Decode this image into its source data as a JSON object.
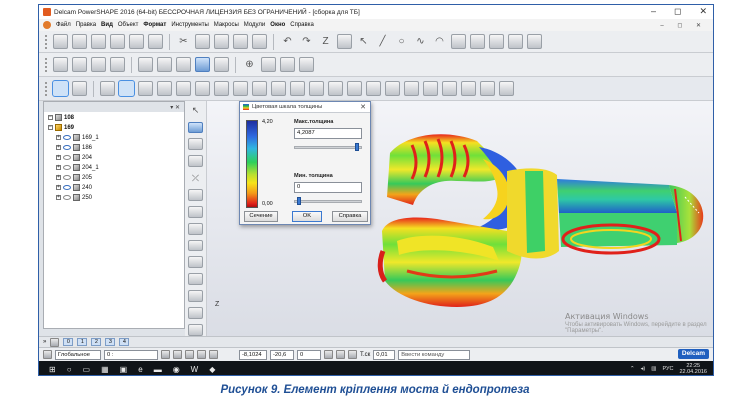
{
  "window": {
    "title": "Delcam PowerSHAPE 2016 (64-bit) БЕССРОЧНАЯ ЛИЦЕНЗИЯ БЕЗ ОГРАНИЧЕНИЙ - [сборка для ТБ]",
    "controls": [
      "–",
      "◻",
      "✕"
    ]
  },
  "menu": {
    "items": [
      "Файл",
      "Правка",
      "Вид",
      "Объект",
      "Формат",
      "Инструменты",
      "Макросы",
      "Модули",
      "Окно",
      "Справка"
    ],
    "mdi_controls": "– ◻ ✕"
  },
  "tree": {
    "header_controls": "▾ ✕",
    "nodes": [
      {
        "id": "n0",
        "label": "108",
        "bold": true,
        "level": 0
      },
      {
        "id": "n1",
        "label": "169",
        "bold": true,
        "level": 0
      },
      {
        "id": "n2",
        "label": "169_1",
        "bold": false,
        "level": 1
      },
      {
        "id": "n3",
        "label": "186",
        "bold": false,
        "level": 1
      },
      {
        "id": "n4",
        "label": "204",
        "bold": false,
        "level": 1
      },
      {
        "id": "n5",
        "label": "204_1",
        "bold": false,
        "level": 1
      },
      {
        "id": "n6",
        "label": "205",
        "bold": false,
        "level": 1
      },
      {
        "id": "n7",
        "label": "240",
        "bold": false,
        "level": 1
      },
      {
        "id": "n8",
        "label": "250",
        "bold": false,
        "level": 1
      }
    ]
  },
  "dialog": {
    "title": "Цветовая шкала толщины",
    "scale_max_value": "4,20",
    "scale_min_value": "0,00",
    "max_label": "Макс.толщина",
    "max_value": "4,2087",
    "max_slider_level": 0.95,
    "min_label": "Мин. толщина",
    "min_value": "0",
    "min_slider_level": 0.05,
    "buttons": {
      "section": "Сечение",
      "ok": "OK",
      "help": "Справка"
    }
  },
  "viewport": {
    "watermark_title": "Активация Windows",
    "watermark_sub": "Чтобы активировать Windows, перейдите в раздел \"Параметры\".",
    "axis_label": "Z"
  },
  "layers": {
    "items": [
      "0",
      "1",
      "2",
      "3",
      "4"
    ]
  },
  "status": {
    "workplane": "Глобальное",
    "layer": "0 :",
    "x": "-8,1024",
    "y": "-20,6",
    "z": "0",
    "tolerance_label": "Т.ск",
    "tolerance": "0,01",
    "command_placeholder": "Ввести команду",
    "brand": "Delcam"
  },
  "taskbar": {
    "lang": "РУС",
    "time": "22:25",
    "date": "22.04.2016"
  },
  "caption": "Рисунок 9. Елемент кріплення моста й ендопротеза",
  "colors": {
    "accent": "#1f4f95",
    "thickness_min": "#e0211a",
    "thickness_max": "#1e2ea0"
  }
}
